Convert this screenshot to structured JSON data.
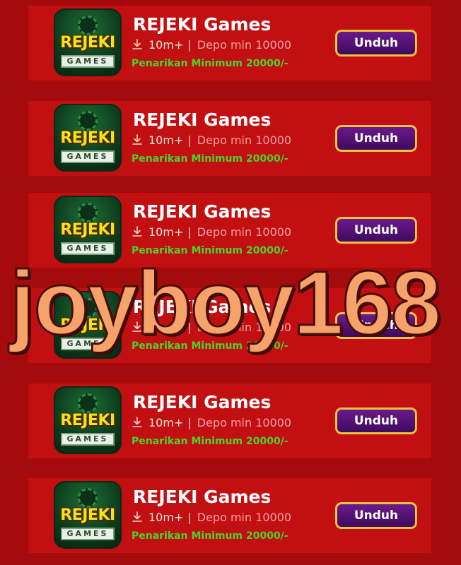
{
  "apps": [
    {
      "icon_brand": "REJEKI",
      "icon_sub": "GAMES",
      "title": "REJEKI Games",
      "downloads": "10m+",
      "separator": "|",
      "deposit": "Depo min 10000",
      "withdraw": "Penarikan Minimum 20000/-",
      "button": "Unduh"
    },
    {
      "icon_brand": "REJEKI",
      "icon_sub": "GAMES",
      "title": "REJEKI Games",
      "downloads": "10m+",
      "separator": "|",
      "deposit": "Depo min 10000",
      "withdraw": "Penarikan Minimum 20000/-",
      "button": "Unduh"
    },
    {
      "icon_brand": "REJEKI",
      "icon_sub": "GAMES",
      "title": "REJEKI Games",
      "downloads": "10m+",
      "separator": "|",
      "deposit": "Depo min 10000",
      "withdraw": "Penarikan Minimum 20000/-",
      "button": "Unduh"
    },
    {
      "icon_brand": "REJEKI",
      "icon_sub": "GAMES",
      "title": "REJEKI Games",
      "downloads": "10m+",
      "separator": "|",
      "deposit": "Depo min 10000",
      "withdraw": "Penarikan Minimum 20000/-",
      "button": "Unduh"
    },
    {
      "icon_brand": "REJEKI",
      "icon_sub": "GAMES",
      "title": "REJEKI Games",
      "downloads": "10m+",
      "separator": "|",
      "deposit": "Depo min 10000",
      "withdraw": "Penarikan Minimum 20000/-",
      "button": "Unduh"
    },
    {
      "icon_brand": "REJEKI",
      "icon_sub": "GAMES",
      "title": "REJEKI Games",
      "downloads": "10m+",
      "separator": "|",
      "deposit": "Depo min 10000",
      "withdraw": "Penarikan Minimum 20000/-",
      "button": "Unduh"
    }
  ],
  "watermark": "joyboy168",
  "icons": {
    "download": "download-icon"
  },
  "colors": {
    "background": "#a50a0c",
    "row": "#c20f12",
    "button": "#4f1170",
    "button_border": "#f1c23d",
    "withdraw": "#4ad42a",
    "deposit": "#f3a1a6",
    "watermark": "#f5a36a"
  }
}
